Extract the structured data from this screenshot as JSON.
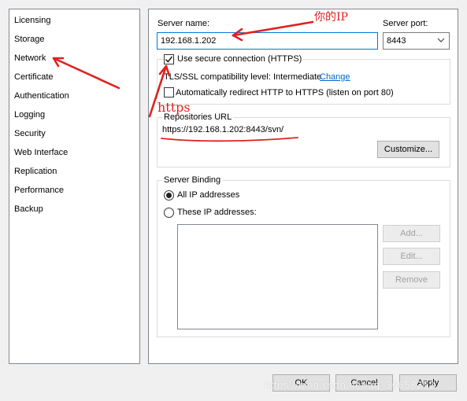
{
  "sidebar": {
    "items": [
      {
        "label": "Licensing"
      },
      {
        "label": "Storage"
      },
      {
        "label": "Network",
        "selected": true
      },
      {
        "label": "Certificate"
      },
      {
        "label": "Authentication"
      },
      {
        "label": "Logging"
      },
      {
        "label": "Security"
      },
      {
        "label": "Web Interface"
      },
      {
        "label": "Replication"
      },
      {
        "label": "Performance"
      },
      {
        "label": "Backup"
      }
    ]
  },
  "network": {
    "server_name_label": "Server name:",
    "server_name_value": "192.168.1.202",
    "server_port_label": "Server port:",
    "server_port_value": "8443",
    "secure_connection_label": "Use secure connection (HTTPS)",
    "secure_connection_checked": true,
    "tls_label": "TLS/SSL compatibility level: Intermediate",
    "tls_change_link": "Change",
    "redirect_label": "Automatically redirect HTTP to HTTPS (listen on port 80)",
    "redirect_checked": false,
    "repos_group_title": "Repositories URL",
    "repos_url": "https://192.168.1.202:8443/svn/",
    "customize_button": "Customize...",
    "binding_group_title": "Server Binding",
    "all_ip_label": "All IP addresses",
    "these_ip_label": "These IP addresses:",
    "add_button": "Add...",
    "edit_button": "Edit...",
    "remove_button": "Remove"
  },
  "dialog_buttons": {
    "ok": "OK",
    "cancel": "Cancel",
    "apply": "Apply"
  },
  "annotations": {
    "ip_note": "你的IP",
    "https_note": "https",
    "color": "#e02020"
  },
  "watermark": "https://blog.csdn.net/qq_36658252"
}
